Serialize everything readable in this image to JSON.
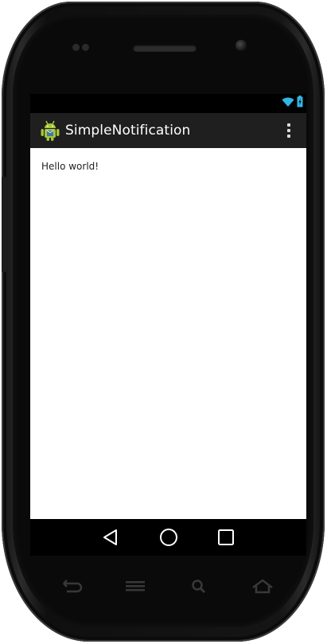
{
  "app": {
    "title": "SimpleNotification",
    "content_text": "Hello world!"
  },
  "status_bar": {
    "icons": [
      "wifi-icon",
      "battery-icon"
    ]
  },
  "nav_bar": {
    "buttons": [
      "back-icon",
      "home-icon",
      "recents-icon"
    ]
  },
  "hardware_buttons": [
    "back-icon",
    "menu-icon",
    "search-icon",
    "home-icon"
  ],
  "colors": {
    "action_bar": "#1f1f1f",
    "status_accent": "#33b5e5",
    "android_green": "#a4c639",
    "content_bg": "#ffffff"
  }
}
